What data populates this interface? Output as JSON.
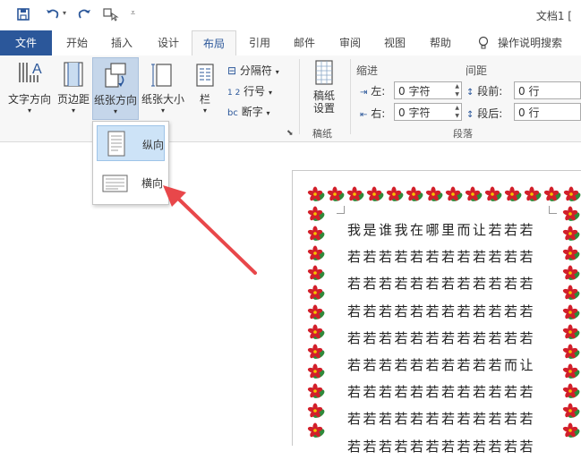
{
  "title_bar": {
    "document_title": "文档1 ["
  },
  "tabs": [
    {
      "label": "文件"
    },
    {
      "label": "开始"
    },
    {
      "label": "插入"
    },
    {
      "label": "设计"
    },
    {
      "label": "布局"
    },
    {
      "label": "引用"
    },
    {
      "label": "邮件"
    },
    {
      "label": "审阅"
    },
    {
      "label": "视图"
    },
    {
      "label": "帮助"
    }
  ],
  "tell_me": "操作说明搜索",
  "ribbon": {
    "text_direction": "文字方向",
    "margins": "页边距",
    "orientation": "纸张方向",
    "size": "纸张大小",
    "columns": "栏",
    "breaks": "分隔符",
    "line_numbers": "行号",
    "hyphenation": "断字",
    "draft_paper": "稿纸\n设置",
    "draft_group": "稿纸",
    "indent_label": "缩进",
    "spacing_label": "间距",
    "left_label": "左:",
    "right_label": "右:",
    "before_label": "段前:",
    "after_label": "段后:",
    "indent_left": "0 字符",
    "indent_right": "0 字符",
    "space_before": "0 行",
    "space_after": "0 行",
    "paragraph_group": "段落"
  },
  "orientation_menu": {
    "portrait": "纵向",
    "landscape": "横向"
  },
  "document": {
    "lines": [
      "我是谁我在哪里而让若若若",
      "若若若若若若若若若若若若",
      "若若若若若若若若若若若若",
      "若若若若若若若若若若若若",
      "若若若若若若若若若若若若",
      "若若若若若若若若若若而让",
      "若若若若若若若若若若若若",
      "若若若若若若若若若若若若",
      "若若若若若若若若若若若若"
    ]
  },
  "colors": {
    "file_tab": "#2b579a",
    "accent": "#2b579a",
    "arrow": "#e8474a"
  }
}
